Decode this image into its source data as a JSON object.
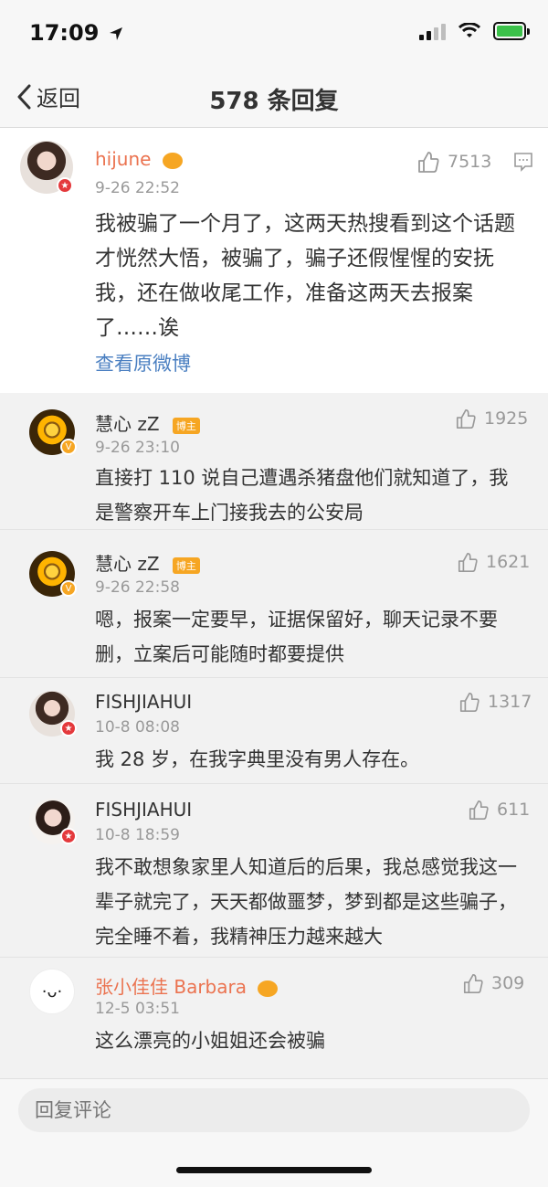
{
  "status_bar": {
    "time": "17:09"
  },
  "nav": {
    "back_label": "返回",
    "title": "578 条回复"
  },
  "main_comment": {
    "username": "hijune",
    "time": "9-26 22:52",
    "likes": "7513",
    "content": "我被骗了一个月了，这两天热搜看到这个话题才恍然大悟，被骗了，骗子还假惺惺的安抚我，还在做收尾工作，准备这两天去报案了……诶",
    "view_original": "查看原微博"
  },
  "replies": [
    {
      "username": "慧心 zZ",
      "tag": "博主",
      "time": "9-26 23:10",
      "likes": "1925",
      "content": "直接打 110 说自己遭遇杀猪盘他们就知道了，我是警察开车上门接我去的公安局"
    },
    {
      "username": "慧心 zZ",
      "tag": "博主",
      "time": "9-26 22:58",
      "likes": "1621",
      "content": "嗯，报案一定要早，证据保留好，聊天记录不要删，立案后可能随时都要提供"
    },
    {
      "username": "FISHJIAHUI",
      "time": "10-8 08:08",
      "likes": "1317",
      "content": "我 28 岁，在我字典里没有男人存在。"
    },
    {
      "username": "FISHJIAHUI",
      "time": "10-8 18:59",
      "likes": "611",
      "content": "我不敢想象家里人知道后的后果，我总感觉我这一辈子就完了，天天都做噩梦，梦到都是这些骗子，完全睡不着，我精神压力越来越大"
    },
    {
      "username": "张小佳佳 Barbara",
      "time": "12-5 03:51",
      "likes": "309",
      "content": "这么漂亮的小姐姐还会被骗"
    }
  ],
  "comment_bar": {
    "placeholder": "回复评论"
  },
  "colors": {
    "link_blue": "#4a7fc1",
    "orange_username": "#eb7350",
    "tag_orange": "#f6a623",
    "badge_red": "#e4393c",
    "muted": "#999999"
  },
  "icons": [
    "location-arrow-icon",
    "signal-icon",
    "wifi-icon",
    "battery-icon",
    "chevron-left-icon",
    "thumbs-up-icon",
    "comment-icon",
    "crown-icon",
    "verified-badge-icon"
  ]
}
